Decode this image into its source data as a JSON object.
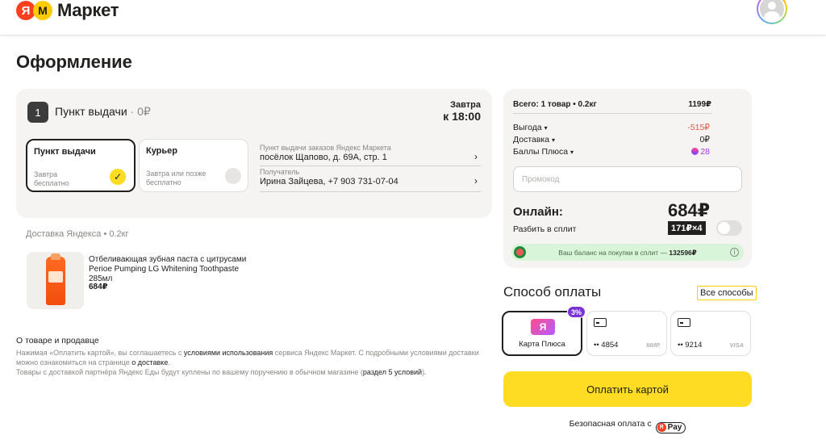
{
  "header": {
    "logo_ya": "Я",
    "logo_m": "M",
    "logo_text": "Маркет"
  },
  "page_title": "Оформление",
  "delivery": {
    "step_number": "1",
    "step_title": "Пункт выдачи",
    "step_price": " · 0₽",
    "when_line1": "Завтра",
    "when_line2": "к 18:00",
    "options": [
      {
        "title": "Пункт выдачи",
        "sub1": "Завтра",
        "sub2": "бесплатно",
        "selected": true
      },
      {
        "title": "Курьер",
        "sub1": "Завтра или позже",
        "sub2": "бесплатно",
        "selected": false
      }
    ],
    "pickup_label": "Пункт выдачи заказов Яндекс Маркета",
    "pickup_address": "посёлок Щапово, д. 69А, стр. 1",
    "recipient_label": "Получатель",
    "recipient_value": "Ирина Зайцева, +7 903 731-07-04",
    "meta": "Доставка Яндекса • 0.2кг"
  },
  "product": {
    "name": "Отбеливающая зубная паста с цитрусами Perioe Pumping LG Whitening Toothpaste 285мл",
    "price": "684₽"
  },
  "legal": {
    "title": "О товаре и продавце",
    "p1_a": "Нажимая «Оплатить картой», вы соглашаетесь с ",
    "p1_link": "условиями использования",
    "p1_b": " сервиса Яндекс Маркет. С подробными условиями доставки можно ознакомиться на странице ",
    "p1_link2": "о доставке",
    "p1_c": ".",
    "p2_a": "Товары с доставкой партнёра Яндекс Еды будут куплены по вашему поручению в обычном магазине (",
    "p2_link": "раздел 5 условий",
    "p2_b": ")."
  },
  "summary": {
    "total_label": "Всего: 1 товар • 0.2кг",
    "total_value": "1199₽",
    "rows": [
      {
        "label": "Выгода",
        "value": "-515₽"
      },
      {
        "label": "Доставка",
        "value": "0₽"
      },
      {
        "label": "Баллы Плюса",
        "value": "28"
      }
    ],
    "promo_placeholder": "Промокод",
    "online_label": "Онлайн:",
    "online_value": "684₽",
    "split_label": "Разбить в сплит",
    "split_badge": "171₽×4",
    "split_toggle_on": false,
    "split_balance_text": "Ваш баланс на покупки в сплит — ",
    "split_balance_value": "132596₽"
  },
  "payment": {
    "title": "Способ оплаты",
    "all_methods": "Все способы",
    "cards": [
      {
        "kind": "plus",
        "name": "Карта Плюса",
        "cashback": "3%",
        "selected": true
      },
      {
        "kind": "card",
        "number": "•• 4854",
        "brand": "МИР",
        "selected": false
      },
      {
        "kind": "card",
        "number": "•• 9214",
        "brand": "VISA",
        "selected": false
      }
    ],
    "pay_button": "Оплатить картой",
    "secure_text": "Безопасная оплата с ",
    "ypay_label": "Pay"
  },
  "colors": {
    "accent_yellow": "#ffdc24",
    "discount_red": "#e0584b",
    "plus_purple": "#a33bd8"
  }
}
